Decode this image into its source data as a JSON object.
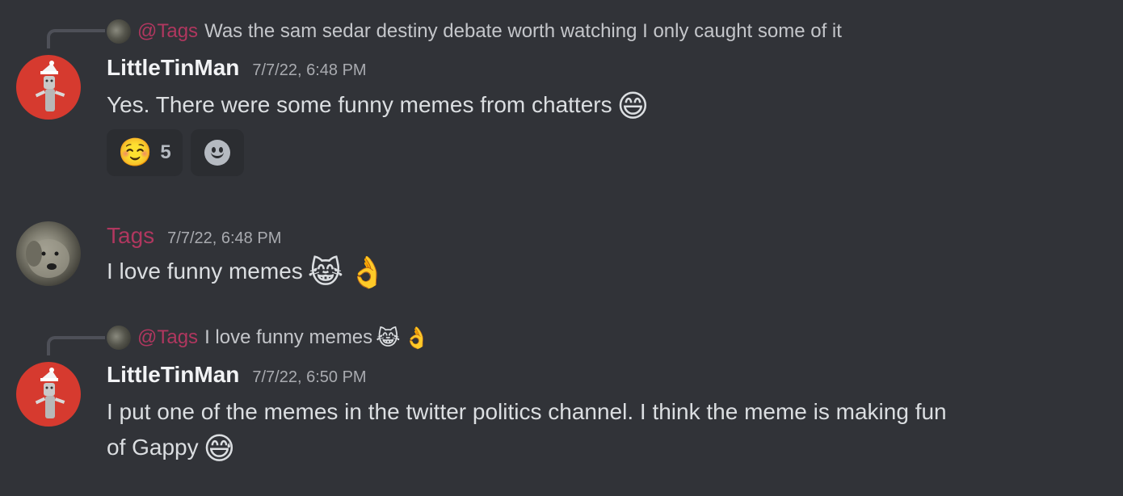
{
  "messages": [
    {
      "reply": {
        "mention": "@Tags",
        "text": "Was the sam sedar destiny debate worth watching I only caught some of it"
      },
      "username": "LittleTinMan",
      "timestamp": "7/7/22, 6:48 PM",
      "text": "Yes. There were some funny memes from chatters",
      "emoji": "😄",
      "reactions": [
        {
          "emoji": "☺️",
          "count": "5"
        }
      ]
    },
    {
      "username": "Tags",
      "timestamp": "7/7/22, 6:48 PM",
      "text": "I love funny memes",
      "emojis": [
        "😹",
        "👌"
      ]
    },
    {
      "reply": {
        "mention": "@Tags",
        "text": "I love funny memes",
        "emojis": [
          "😹",
          "👌"
        ]
      },
      "username": "LittleTinMan",
      "timestamp": "7/7/22, 6:50 PM",
      "text_line1": "I put one of the memes in the twitter politics channel. I think the meme is making fun",
      "text_line2": "of Gappy",
      "emoji": "😅"
    }
  ],
  "icons": {
    "add_reaction": "add-reaction-icon"
  }
}
